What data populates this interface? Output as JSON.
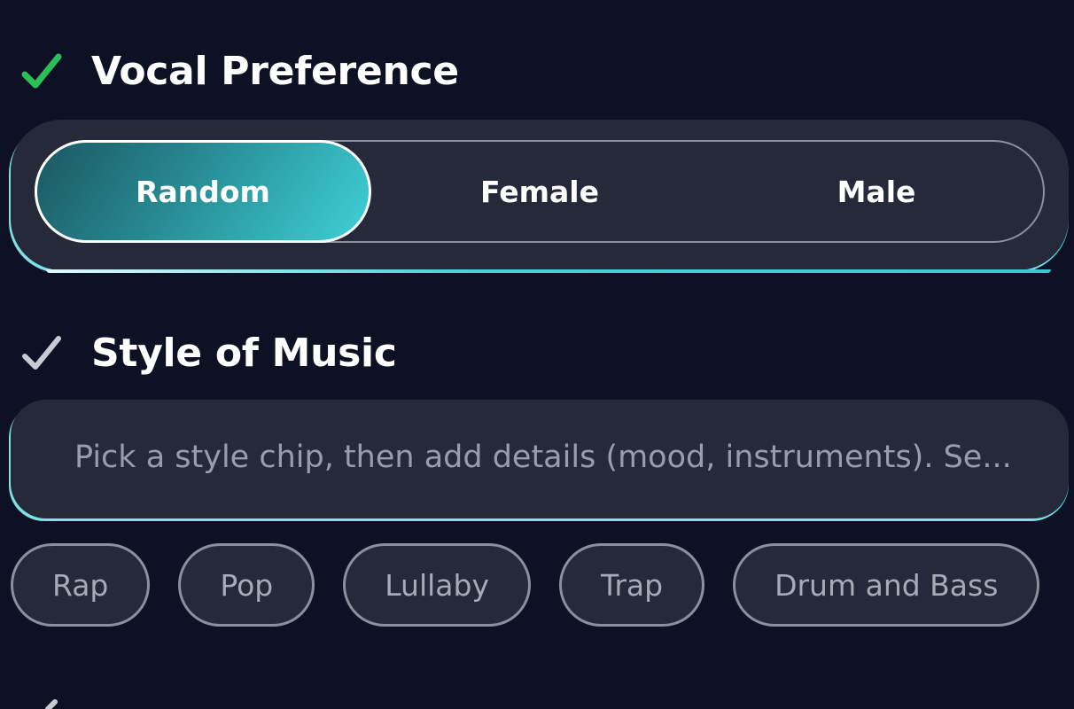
{
  "vocal_preference": {
    "title": "Vocal Preference",
    "options": [
      "Random",
      "Female",
      "Male"
    ],
    "selected": "Random",
    "check_color": "#2bbf5a"
  },
  "style_of_music": {
    "title": "Style of Music",
    "input_placeholder": "Pick a style chip, then add details (mood, instruments). Se...",
    "input_value": "",
    "chips": [
      "Rap",
      "Pop",
      "Lullaby",
      "Trap",
      "Drum and Bass"
    ],
    "check_color": "#c9cad6"
  },
  "next_section": {
    "icon": "check-icon"
  },
  "colors": {
    "background": "#0e1124",
    "panel": "#252939",
    "accent": "#3ed1d6"
  }
}
